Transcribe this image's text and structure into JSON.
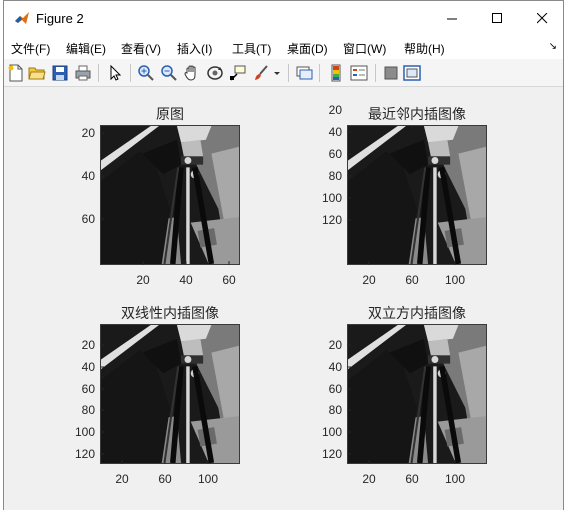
{
  "window": {
    "title": "Figure 2"
  },
  "menu": {
    "items": [
      "文件(F)",
      "编辑(E)",
      "查看(V)",
      "插入(I)",
      "工具(T)",
      "桌面(D)",
      "窗口(W)",
      "帮助(H)"
    ],
    "overflow_arrow": "↘"
  },
  "toolbar": {
    "icons": [
      "new-figure-icon",
      "open-file-icon",
      "save-icon",
      "print-icon",
      "pointer-icon",
      "zoom-in-icon",
      "zoom-out-icon",
      "pan-hand-icon",
      "rotate-3d-icon",
      "data-cursor-icon",
      "brush-icon",
      "brush-dropdown-icon",
      "link-plot-icon",
      "colorbar-icon",
      "legend-icon",
      "hide-plot-tools-icon",
      "show-plot-tools-icon"
    ]
  },
  "plots": {
    "p1": {
      "title": "原图",
      "yticks": [
        "20",
        "40",
        "60"
      ],
      "xticks": [
        "20",
        "40",
        "60"
      ]
    },
    "p2": {
      "title": "最近邻内插图像",
      "yticks": [
        "20",
        "40",
        "60",
        "80",
        "100",
        "120"
      ],
      "xticks": [
        "20",
        "60",
        "100"
      ]
    },
    "p3": {
      "title": "双线性内插图像",
      "yticks": [
        "20",
        "40",
        "60",
        "80",
        "100",
        "120"
      ],
      "xticks": [
        "20",
        "60",
        "100"
      ]
    },
    "p4": {
      "title": "双立方内插图像",
      "yticks": [
        "20",
        "40",
        "60",
        "80",
        "100",
        "120"
      ],
      "xticks": [
        "20",
        "60",
        "100"
      ]
    }
  },
  "colors": {
    "accent_matlab": "#e46c0a",
    "canvas": "#f0f0f0"
  }
}
